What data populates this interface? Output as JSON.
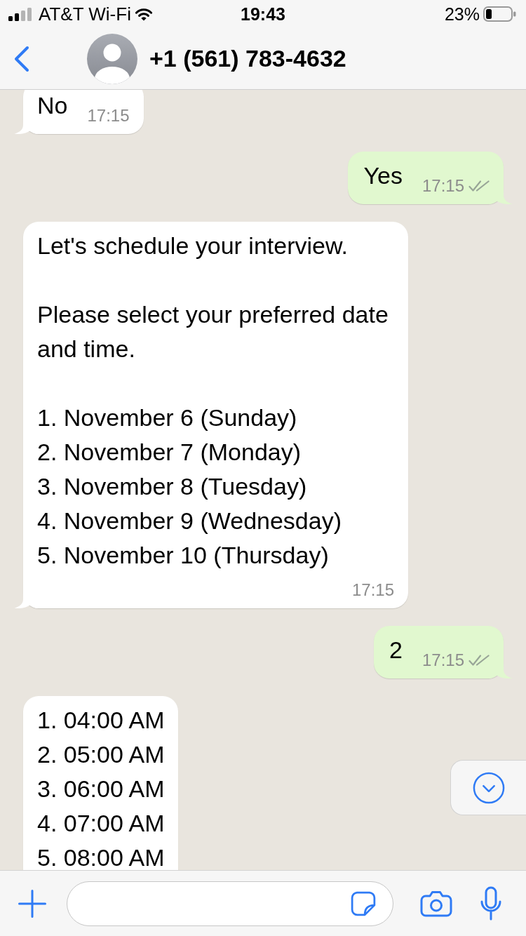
{
  "status_bar": {
    "carrier": "AT&T Wi-Fi",
    "time": "19:43",
    "battery": "23%"
  },
  "header": {
    "title": "+1 (561) 783-4632"
  },
  "messages": [
    {
      "kind": "incoming",
      "paragraphs": [
        [
          "No"
        ]
      ],
      "time": "17:15"
    },
    {
      "kind": "outgoing",
      "paragraphs": [
        [
          "Yes"
        ]
      ],
      "time": "17:15",
      "read": false
    },
    {
      "kind": "incoming",
      "paragraphs": [
        [
          "Let's schedule your interview."
        ],
        [
          "Please select your preferred date and time."
        ],
        [
          "1. November 6 (Sunday)",
          "2. November 7 (Monday)",
          "3. November 8 (Tuesday)",
          "4. November 9 (Wednesday)",
          "5. November 10 (Thursday)"
        ]
      ],
      "time": "17:15"
    },
    {
      "kind": "outgoing",
      "paragraphs": [
        [
          "2"
        ]
      ],
      "time": "17:15",
      "read": false
    },
    {
      "kind": "incoming",
      "paragraphs": [
        [
          "1. 04:00 AM",
          "2. 05:00 AM",
          "3. 06:00 AM",
          "4. 07:00 AM",
          "5. 08:00 AM"
        ]
      ]
    }
  ]
}
